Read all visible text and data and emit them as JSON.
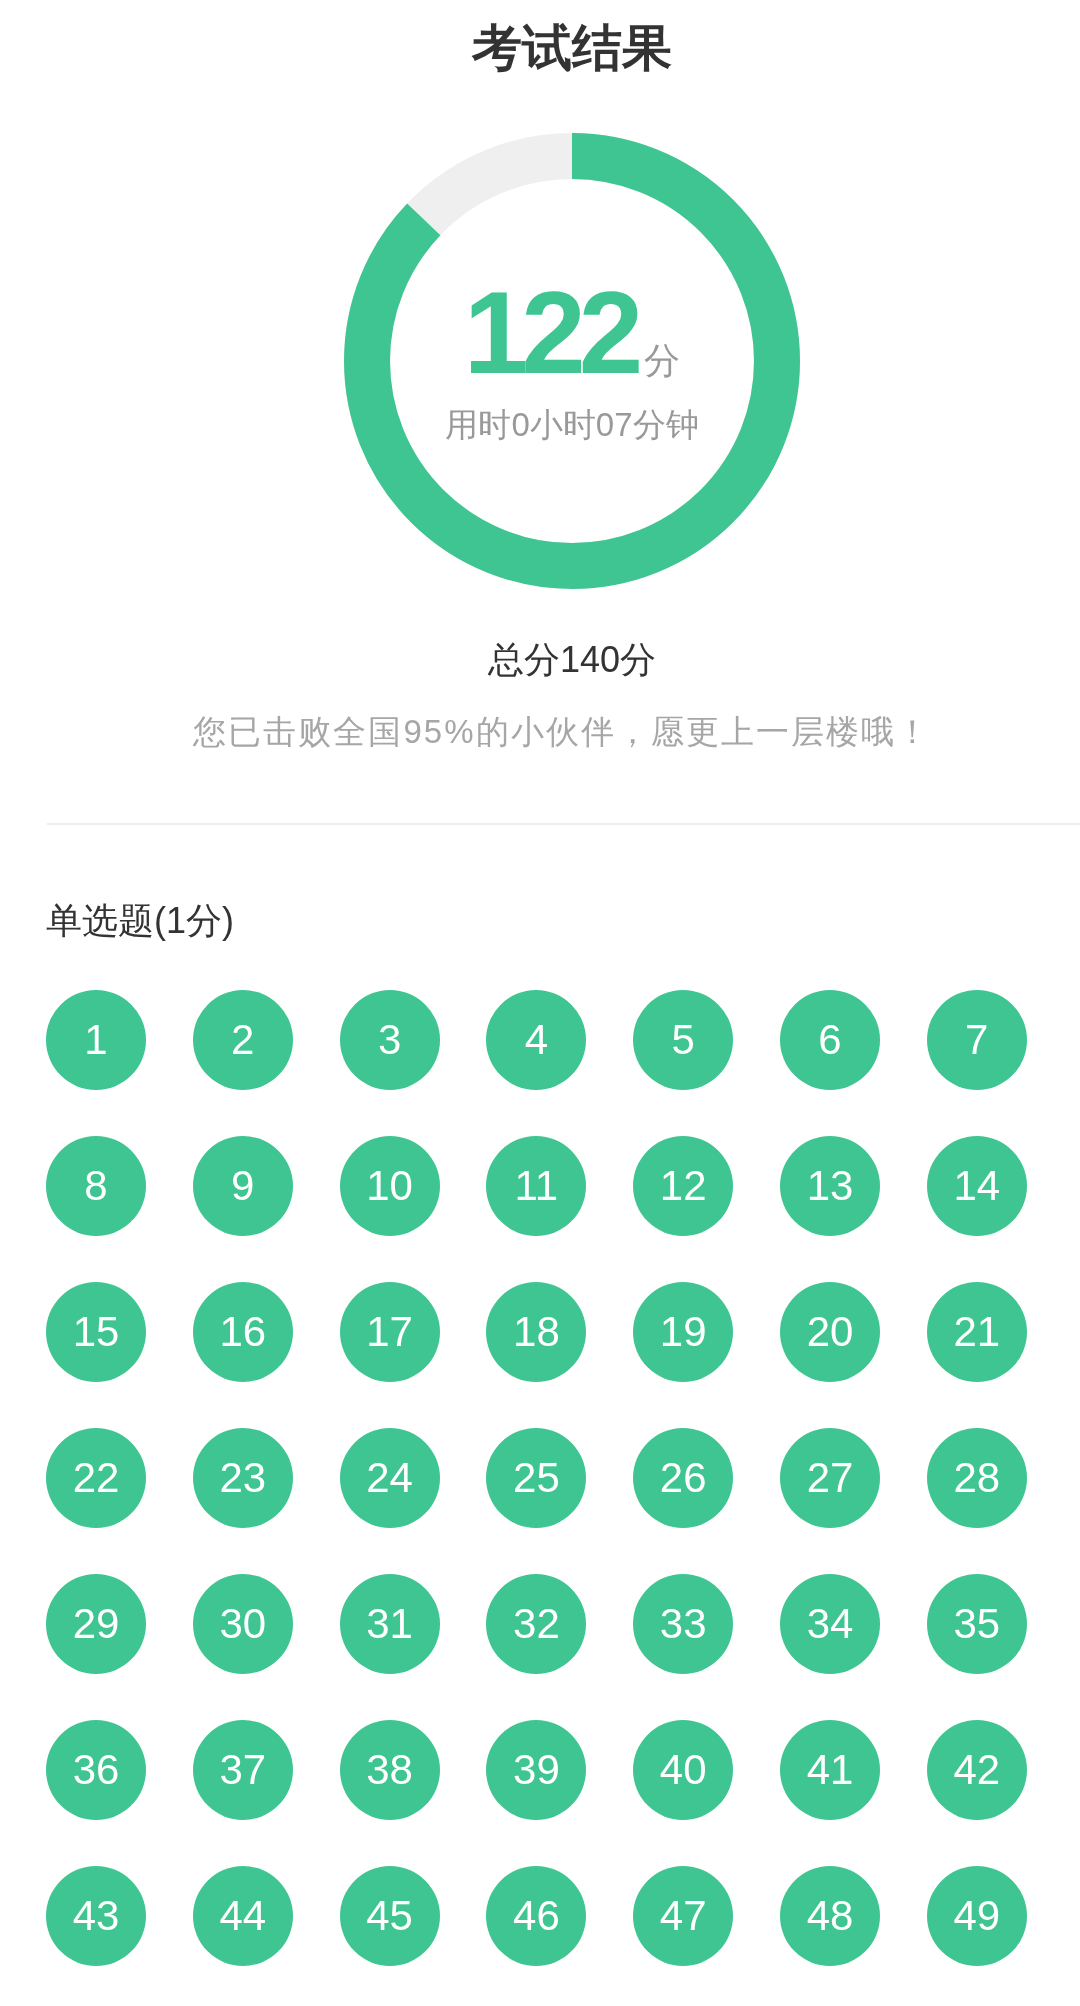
{
  "header": {
    "title": "考试结果"
  },
  "score_ring": {
    "level": 0.871,
    "score": "122",
    "unit": "分",
    "time_used": "用时0小时07分钟"
  },
  "summary": {
    "total": "总分140分",
    "ranking": "您已击败全国95%的小伙伴，愿更上一层楼哦！"
  },
  "sections": [
    {
      "title": "单选题(1分)",
      "questions": [
        {
          "number": "1",
          "correct": true
        },
        {
          "number": "2",
          "correct": true
        },
        {
          "number": "3",
          "correct": true
        },
        {
          "number": "4",
          "correct": true
        },
        {
          "number": "5",
          "correct": true
        },
        {
          "number": "6",
          "correct": true
        },
        {
          "number": "7",
          "correct": true
        },
        {
          "number": "8",
          "correct": true
        },
        {
          "number": "9",
          "correct": true
        },
        {
          "number": "10",
          "correct": true
        },
        {
          "number": "11",
          "correct": true
        },
        {
          "number": "12",
          "correct": true
        },
        {
          "number": "13",
          "correct": true
        },
        {
          "number": "14",
          "correct": true
        },
        {
          "number": "15",
          "correct": true
        },
        {
          "number": "16",
          "correct": true
        },
        {
          "number": "17",
          "correct": true
        },
        {
          "number": "18",
          "correct": true
        },
        {
          "number": "19",
          "correct": true
        },
        {
          "number": "20",
          "correct": true
        },
        {
          "number": "21",
          "correct": true
        },
        {
          "number": "22",
          "correct": true
        },
        {
          "number": "23",
          "correct": true
        },
        {
          "number": "24",
          "correct": true
        },
        {
          "number": "25",
          "correct": true
        },
        {
          "number": "26",
          "correct": true
        },
        {
          "number": "27",
          "correct": true
        },
        {
          "number": "28",
          "correct": true
        },
        {
          "number": "29",
          "correct": true
        },
        {
          "number": "30",
          "correct": true
        },
        {
          "number": "31",
          "correct": true
        },
        {
          "number": "32",
          "correct": true
        },
        {
          "number": "33",
          "correct": true
        },
        {
          "number": "34",
          "correct": true
        },
        {
          "number": "35",
          "correct": true
        },
        {
          "number": "36",
          "correct": true
        },
        {
          "number": "37",
          "correct": true
        },
        {
          "number": "38",
          "correct": true
        },
        {
          "number": "39",
          "correct": true
        },
        {
          "number": "40",
          "correct": true
        },
        {
          "number": "41",
          "correct": true
        },
        {
          "number": "42",
          "correct": true
        },
        {
          "number": "43",
          "correct": true
        },
        {
          "number": "44",
          "correct": true
        },
        {
          "number": "45",
          "correct": true
        },
        {
          "number": "46",
          "correct": true
        },
        {
          "number": "47",
          "correct": true
        },
        {
          "number": "48",
          "correct": true
        },
        {
          "number": "49",
          "correct": true
        }
      ]
    }
  ]
}
